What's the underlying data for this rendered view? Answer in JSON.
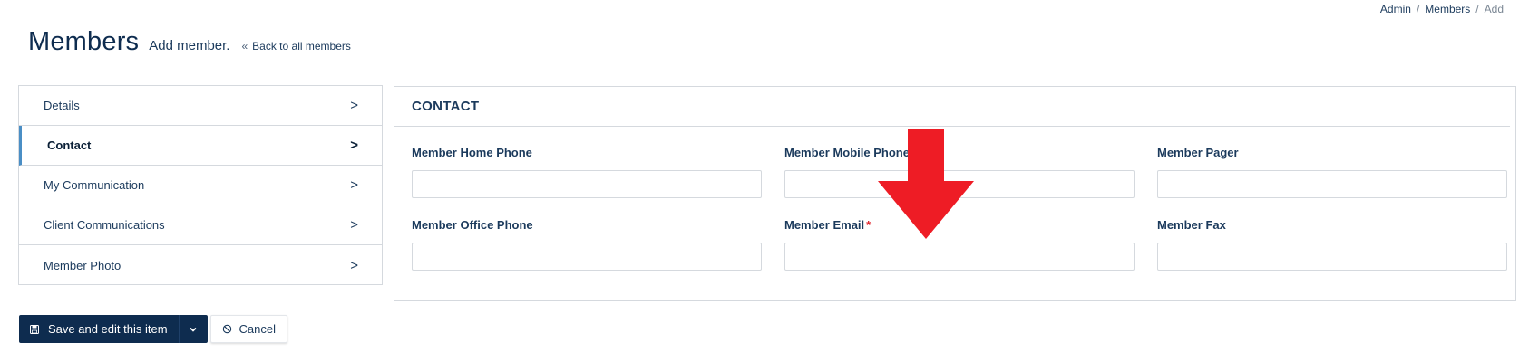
{
  "breadcrumb": {
    "items": [
      "Admin",
      "Members"
    ],
    "current": "Add",
    "separator": "/"
  },
  "header": {
    "title": "Members",
    "subtitle": "Add member.",
    "back_link": "Back to all members"
  },
  "sidebar": {
    "items": [
      {
        "label": "Details",
        "chevron": ">"
      },
      {
        "label": "Contact",
        "chevron": ">",
        "active": true
      },
      {
        "label": "My Communication",
        "chevron": ">"
      },
      {
        "label": "Client Communications",
        "chevron": ">"
      },
      {
        "label": "Member Photo",
        "chevron": ">"
      }
    ]
  },
  "panel": {
    "title": "CONTACT",
    "fields": [
      {
        "label": "Member Home Phone",
        "value": "",
        "required": false
      },
      {
        "label": "Member Mobile Phone",
        "value": "",
        "required": false
      },
      {
        "label": "Member Pager",
        "value": "",
        "required": false
      },
      {
        "label": "Member Office Phone",
        "value": "",
        "required": false
      },
      {
        "label": "Member Email",
        "value": "",
        "required": true,
        "required_mark": "*"
      },
      {
        "label": "Member Fax",
        "value": "",
        "required": false
      }
    ]
  },
  "actions": {
    "save_label": "Save and edit this item",
    "cancel_label": "Cancel"
  },
  "colors": {
    "brand_navy": "#0e2c4f",
    "active_accent": "#4a8ec5",
    "required": "#e0242b",
    "annotation_arrow": "#ee1c25"
  },
  "icons": {
    "save": "floppy-disk-icon",
    "dropdown": "chevron-down-icon",
    "cancel": "ban-icon",
    "back": "double-chevron-left-icon",
    "annotation": "down-arrow-icon"
  }
}
